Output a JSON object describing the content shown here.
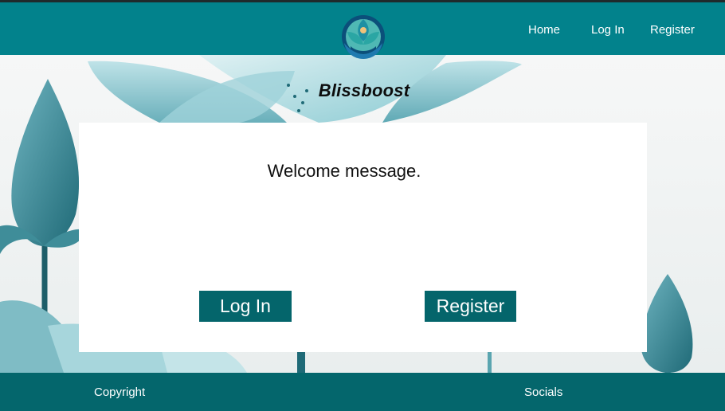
{
  "header": {
    "logo_icon": "lotus-meditation-logo",
    "nav": [
      {
        "label": "Home"
      },
      {
        "label": "Log In"
      },
      {
        "label": "Register"
      }
    ],
    "background_color": "#02828c"
  },
  "hero": {
    "background_icon": "lotus-flowers-illustration",
    "brand_name": "Blissboost"
  },
  "card": {
    "welcome_text": "Welcome message.",
    "login_label": "Log In",
    "register_label": "Register",
    "button_color": "#04656b"
  },
  "footer": {
    "copyright": "Copyright",
    "socials": "Socials",
    "background_color": "#04666c"
  }
}
